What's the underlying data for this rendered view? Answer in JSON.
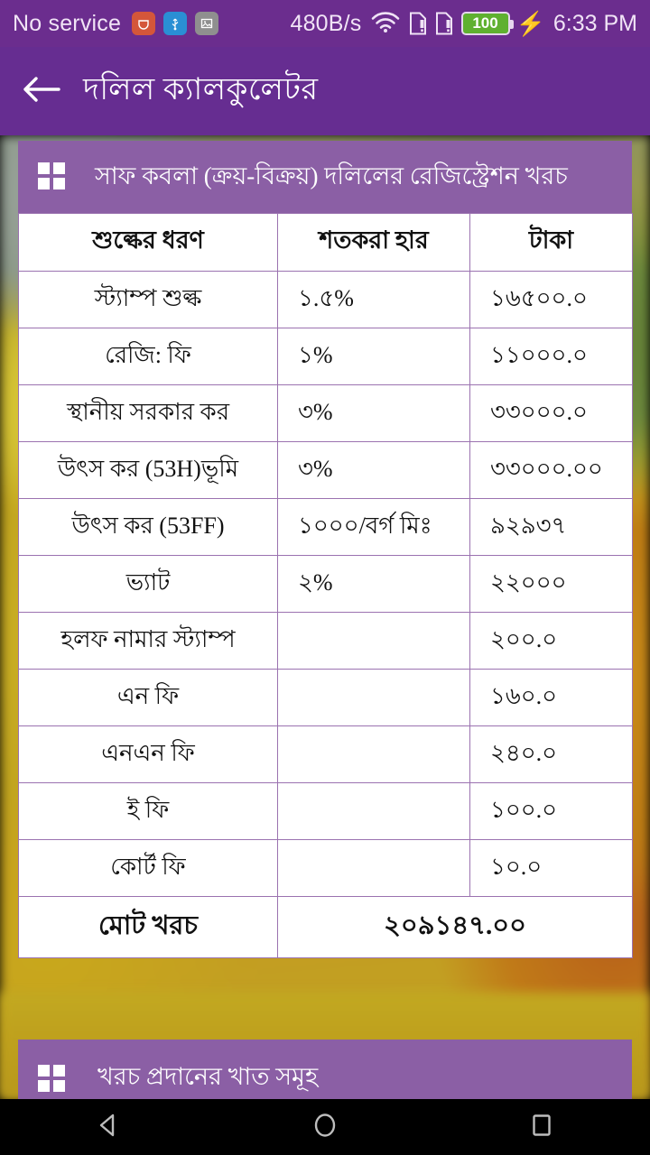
{
  "status_bar": {
    "carrier": "No service",
    "network_speed": "480B/s",
    "battery_level": "100",
    "time": "6:33 PM",
    "icons": [
      "notification-icon",
      "usb-icon",
      "screenshot-icon",
      "wifi-icon",
      "sim1-icon",
      "sim2-icon",
      "battery-icon",
      "charging-bolt-icon"
    ],
    "bg_color": "#6B2D8E"
  },
  "app_bar": {
    "title": "দলিল ক্যালকুলেটর",
    "back_icon": "arrow-left-icon",
    "bg_color": "#662D91"
  },
  "card1": {
    "header": "সাফ কবলা (ক্রয়-বিক্রয়) দলিলের রেজিস্ট্রেশন খরচ",
    "header_icon": "grid-icon",
    "header_bg": "#8B5FA5",
    "border_color": "#9B72B0",
    "columns": [
      "শুল্কের ধরণ",
      "শতকরা হার",
      "টাকা"
    ],
    "rows": [
      {
        "name": "স্ট্যাম্প শুল্ক",
        "rate": "১.৫%",
        "amount": "১৬৫০০.০"
      },
      {
        "name": "রেজি: ফি",
        "rate": "১%",
        "amount": "১১০০০.০"
      },
      {
        "name": "স্থানীয় সরকার কর",
        "rate": "৩%",
        "amount": "৩৩০০০.০"
      },
      {
        "name": "উৎস কর (53H)ভূমি",
        "rate": "৩%",
        "amount": "৩৩০০০.০০"
      },
      {
        "name": "উৎস কর (53FF)",
        "rate": "১০০০/বর্গ মিঃ",
        "amount": "৯২৯৩৭"
      },
      {
        "name": "ভ্যাট",
        "rate": "২%",
        "amount": "২২০০০"
      },
      {
        "name": "হলফ নামার স্ট্যাম্প",
        "rate": "",
        "amount": "২০০.০"
      },
      {
        "name": "এন ফি",
        "rate": "",
        "amount": "১৬০.০"
      },
      {
        "name": "এনএন ফি",
        "rate": "",
        "amount": "২৪০.০"
      },
      {
        "name": "ই ফি",
        "rate": "",
        "amount": "১০০.০"
      },
      {
        "name": "কোর্ট ফি",
        "rate": "",
        "amount": "১০.০"
      }
    ],
    "total_label": "মোট খরচ",
    "total_value": "২০৯১৪৭.০০"
  },
  "card2": {
    "header": "খরচ প্রদানের খাত সমূহ",
    "header_icon": "grid-icon",
    "header_bg": "#8B5FA5"
  },
  "nav_bar": {
    "back": "nav-back-icon",
    "home": "nav-home-icon",
    "recents": "nav-recents-icon"
  }
}
